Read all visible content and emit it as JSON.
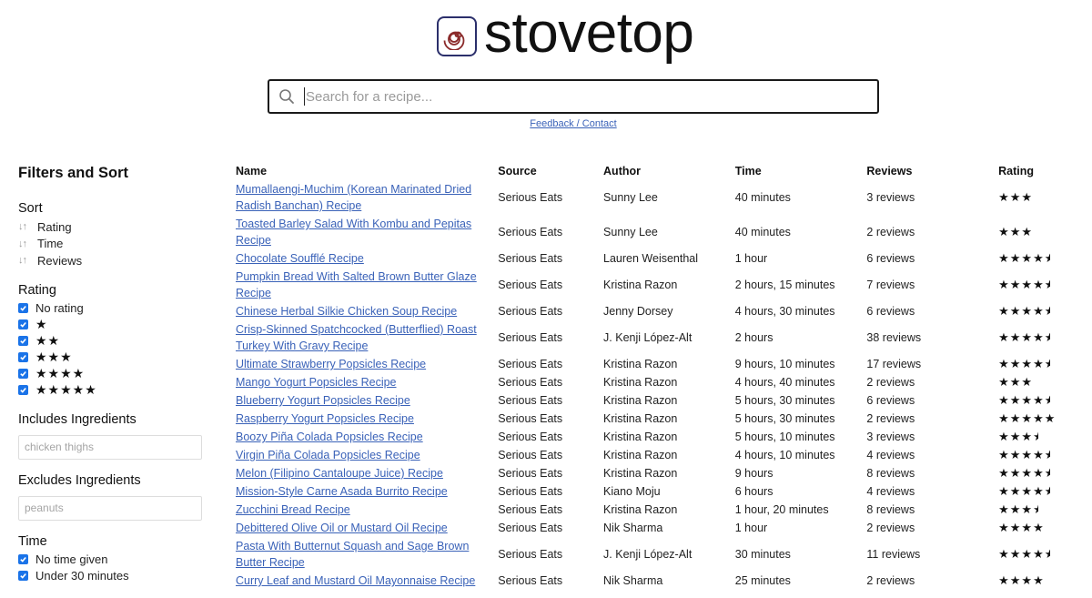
{
  "header": {
    "logo_text": "stovetop",
    "logo_icon": "spiral-burner-icon",
    "search_placeholder": "Search for a recipe...",
    "search_value": "",
    "feedback_link": "Feedback / Contact"
  },
  "colors": {
    "link": "#3a62b8",
    "checkbox": "#1a73e8",
    "logo_border": "#2b2f6b",
    "logo_spiral": "#8b2b2b"
  },
  "sidebar": {
    "title": "Filters and Sort",
    "sort": {
      "heading": "Sort",
      "items": [
        {
          "label": "Rating",
          "icon": "sort-arrows-icon"
        },
        {
          "label": "Time",
          "icon": "sort-arrows-icon"
        },
        {
          "label": "Reviews",
          "icon": "sort-arrows-icon"
        }
      ]
    },
    "rating": {
      "heading": "Rating",
      "items": [
        {
          "label": "No rating",
          "checked": true
        },
        {
          "label": "★",
          "checked": true
        },
        {
          "label": "★★",
          "checked": true
        },
        {
          "label": "★★★",
          "checked": true
        },
        {
          "label": "★★★★",
          "checked": true
        },
        {
          "label": "★★★★★",
          "checked": true
        }
      ]
    },
    "includes": {
      "heading": "Includes Ingredients",
      "placeholder": "chicken thighs",
      "value": ""
    },
    "excludes": {
      "heading": "Excludes Ingredients",
      "placeholder": "peanuts",
      "value": ""
    },
    "time": {
      "heading": "Time",
      "items": [
        {
          "label": "No time given",
          "checked": true
        },
        {
          "label": "Under 30 minutes",
          "checked": true
        }
      ]
    }
  },
  "table": {
    "columns": [
      "Name",
      "Source",
      "Author",
      "Time",
      "Reviews",
      "Rating"
    ],
    "rows": [
      {
        "name": "Mumallaengi-Muchim (Korean Marinated Dried Radish Banchan) Recipe",
        "source": "Serious Eats",
        "author": "Sunny Lee",
        "time": "40 minutes",
        "reviews": "3 reviews",
        "rating": 3
      },
      {
        "name": "Toasted Barley Salad With Kombu and Pepitas Recipe",
        "source": "Serious Eats",
        "author": "Sunny Lee",
        "time": "40 minutes",
        "reviews": "2 reviews",
        "rating": 3
      },
      {
        "name": "Chocolate Soufflé Recipe",
        "source": "Serious Eats",
        "author": "Lauren Weisenthal",
        "time": "1 hour",
        "reviews": "6 reviews",
        "rating": 4.5
      },
      {
        "name": "Pumpkin Bread With Salted Brown Butter Glaze Recipe",
        "source": "Serious Eats",
        "author": "Kristina Razon",
        "time": "2 hours, 15 minutes",
        "reviews": "7 reviews",
        "rating": 4.5
      },
      {
        "name": "Chinese Herbal Silkie Chicken Soup Recipe",
        "source": "Serious Eats",
        "author": "Jenny Dorsey",
        "time": "4 hours, 30 minutes",
        "reviews": "6 reviews",
        "rating": 4.5
      },
      {
        "name": "Crisp-Skinned Spatchcocked (Butterflied) Roast Turkey With Gravy Recipe",
        "source": "Serious Eats",
        "author": "J. Kenji López-Alt",
        "time": "2 hours",
        "reviews": "38 reviews",
        "rating": 4.5
      },
      {
        "name": "Ultimate Strawberry Popsicles Recipe",
        "source": "Serious Eats",
        "author": "Kristina Razon",
        "time": "9 hours, 10 minutes",
        "reviews": "17 reviews",
        "rating": 4.5
      },
      {
        "name": "Mango Yogurt Popsicles Recipe",
        "source": "Serious Eats",
        "author": "Kristina Razon",
        "time": "4 hours, 40 minutes",
        "reviews": "2 reviews",
        "rating": 3
      },
      {
        "name": "Blueberry Yogurt Popsicles Recipe",
        "source": "Serious Eats",
        "author": "Kristina Razon",
        "time": "5 hours, 30 minutes",
        "reviews": "6 reviews",
        "rating": 4.5
      },
      {
        "name": "Raspberry Yogurt Popsicles Recipe",
        "source": "Serious Eats",
        "author": "Kristina Razon",
        "time": "5 hours, 30 minutes",
        "reviews": "2 reviews",
        "rating": 5
      },
      {
        "name": "Boozy Piña Colada Popsicles Recipe",
        "source": "Serious Eats",
        "author": "Kristina Razon",
        "time": "5 hours, 10 minutes",
        "reviews": "3 reviews",
        "rating": 3.5
      },
      {
        "name": "Virgin Piña Colada Popsicles Recipe",
        "source": "Serious Eats",
        "author": "Kristina Razon",
        "time": "4 hours, 10 minutes",
        "reviews": "4 reviews",
        "rating": 4.5
      },
      {
        "name": "Melon (Filipino Cantaloupe Juice) Recipe",
        "source": "Serious Eats",
        "author": "Kristina Razon",
        "time": "9 hours",
        "reviews": "8 reviews",
        "rating": 4.5
      },
      {
        "name": "Mission-Style Carne Asada Burrito Recipe",
        "source": "Serious Eats",
        "author": "Kiano Moju",
        "time": "6 hours",
        "reviews": "4 reviews",
        "rating": 4.5
      },
      {
        "name": "Zucchini Bread Recipe",
        "source": "Serious Eats",
        "author": "Kristina Razon",
        "time": "1 hour, 20 minutes",
        "reviews": "8 reviews",
        "rating": 3.5
      },
      {
        "name": "Debittered Olive Oil or Mustard Oil Recipe",
        "source": "Serious Eats",
        "author": "Nik Sharma",
        "time": "1 hour",
        "reviews": "2 reviews",
        "rating": 4
      },
      {
        "name": "Pasta With Butternut Squash and Sage Brown Butter Recipe",
        "source": "Serious Eats",
        "author": "J. Kenji López-Alt",
        "time": "30 minutes",
        "reviews": "11 reviews",
        "rating": 4.5
      },
      {
        "name": "Curry Leaf and Mustard Oil Mayonnaise Recipe",
        "source": "Serious Eats",
        "author": "Nik Sharma",
        "time": "25 minutes",
        "reviews": "2 reviews",
        "rating": 4
      }
    ]
  }
}
